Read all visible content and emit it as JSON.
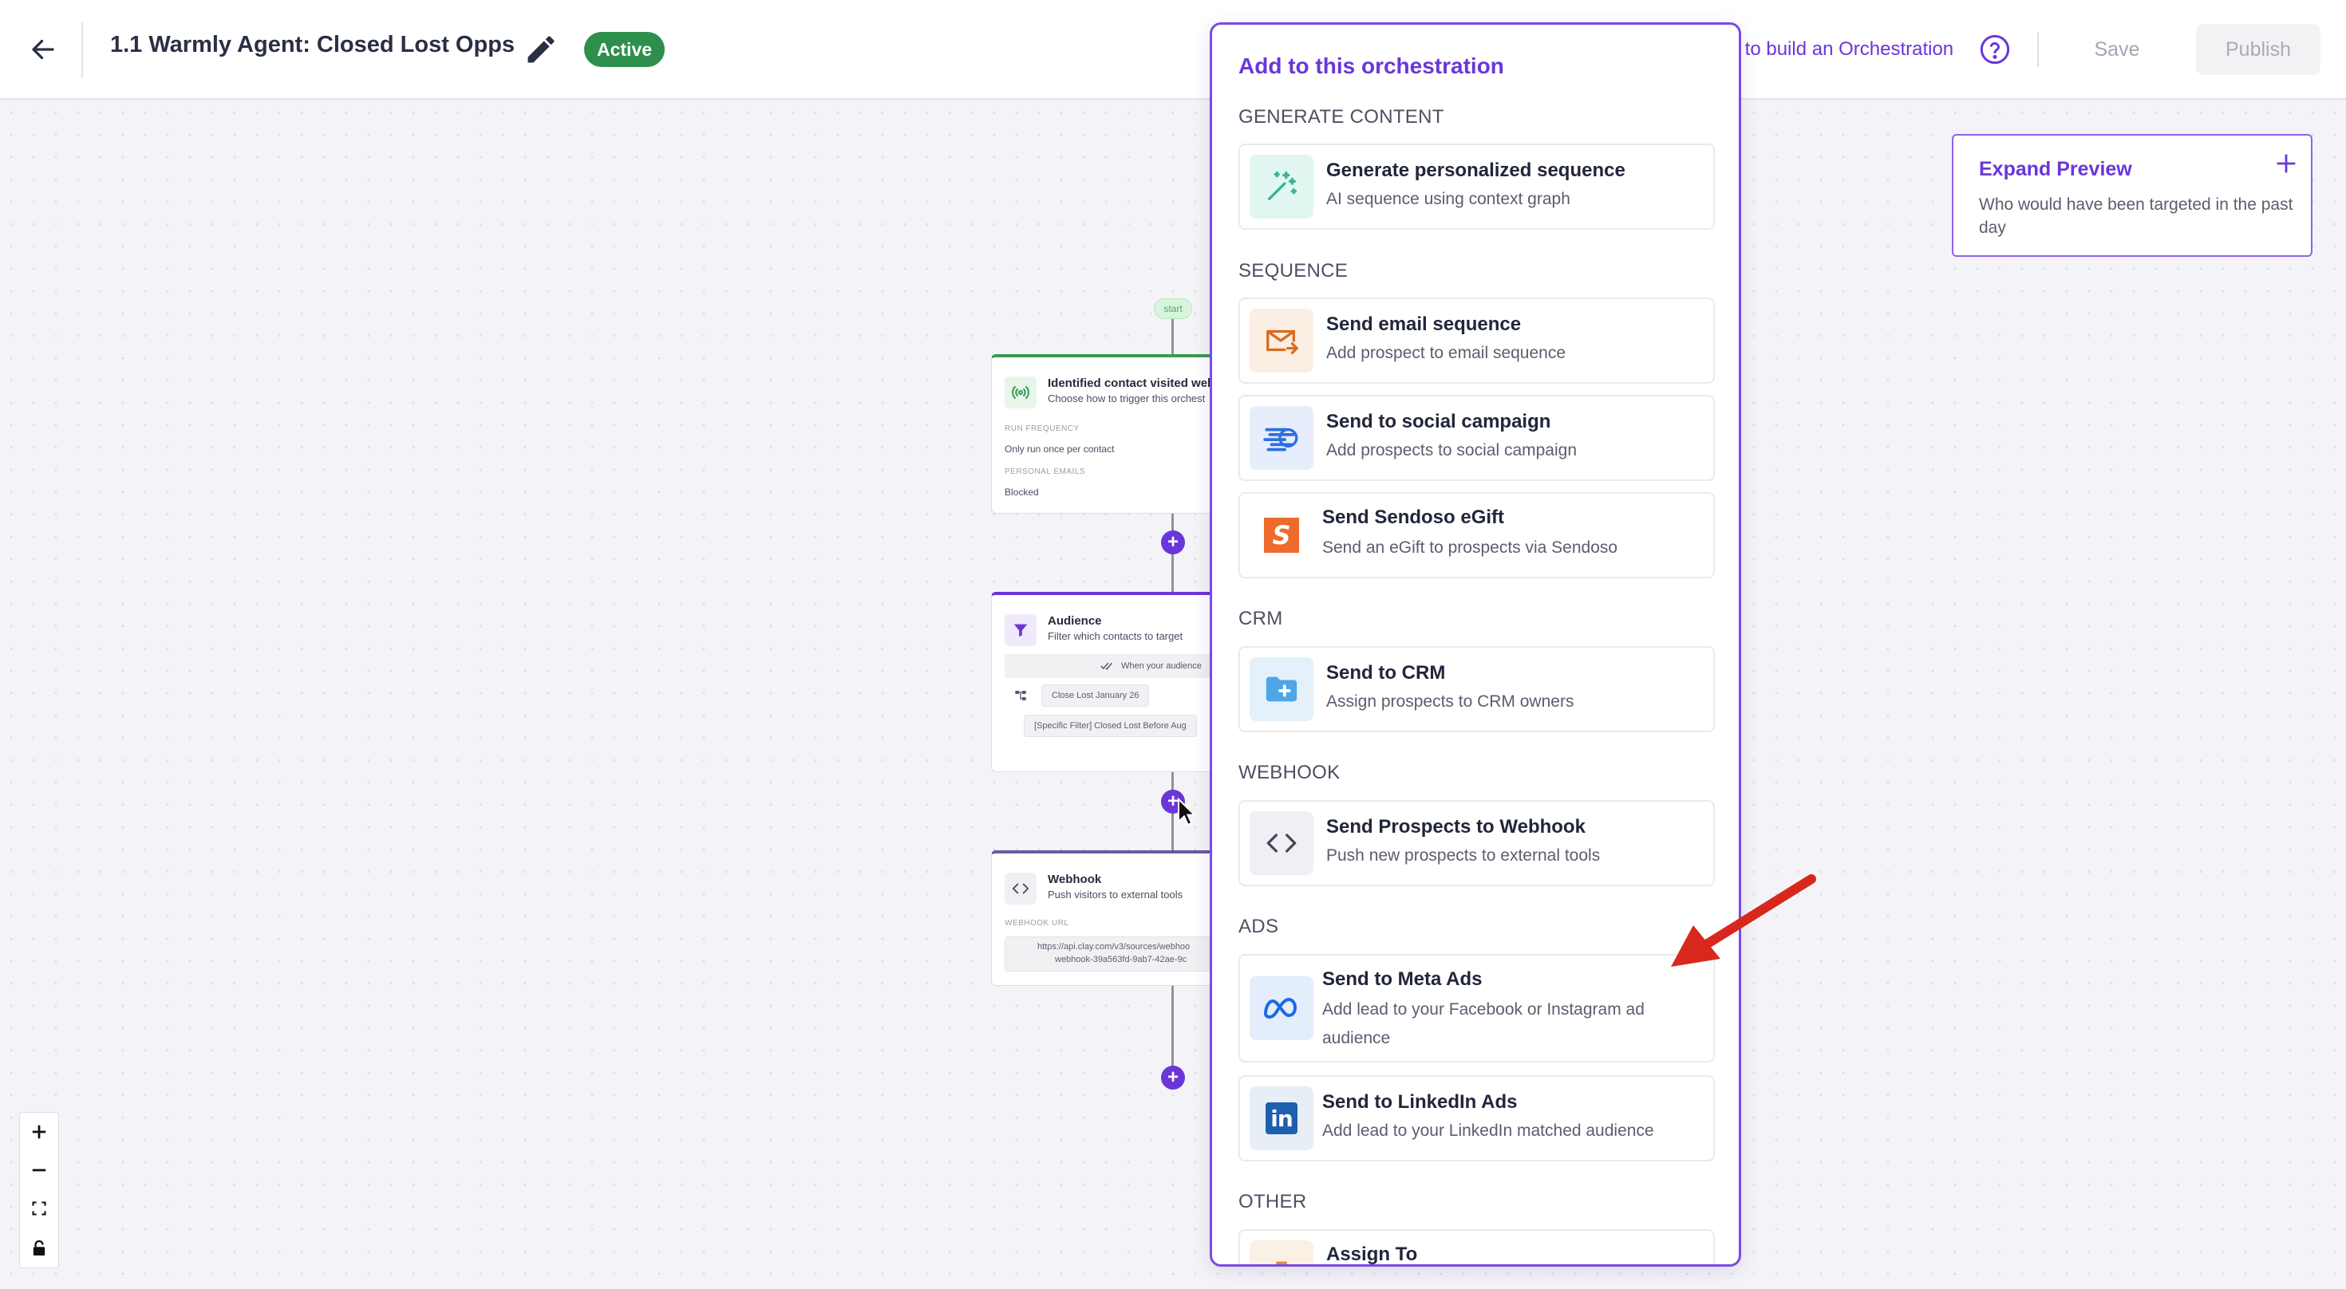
{
  "header": {
    "title": "1.1 Warmly Agent: Closed Lost Opps",
    "status": "Active",
    "help_link": "y to build an Orchestration",
    "save": "Save",
    "publish": "Publish"
  },
  "canvas": {
    "start_label": "start",
    "nodes": [
      {
        "title": "Identified contact visited web",
        "subtitle": "Choose how to trigger this orchest",
        "fields": [
          {
            "label": "RUN FREQUENCY",
            "value": "Only run once per contact"
          },
          {
            "label": "PERSONAL EMAILS",
            "value": "Blocked"
          }
        ]
      },
      {
        "title": "Audience",
        "subtitle": "Filter which contacts to target",
        "condition": "When your audience",
        "chip1": "Close Lost January 26",
        "chip2": "[Specific Filter] Closed Lost Before Aug"
      },
      {
        "title": "Webhook",
        "subtitle": "Push visitors to external tools",
        "field_label": "WEBHOOK URL",
        "url_line1": "https://api.clay.com/v3/sources/webhoo",
        "url_line2": "webhook-39a563fd-9ab7-42ae-9c"
      }
    ]
  },
  "preview": {
    "title": "Expand Preview",
    "description": "Who would have been targeted in the past day"
  },
  "panel": {
    "title": "Add to this orchestration",
    "sections": [
      {
        "heading": "GENERATE CONTENT",
        "items": [
          {
            "title": "Generate personalized sequence",
            "desc": "AI sequence using context graph",
            "icon": "magic-wand-icon"
          }
        ]
      },
      {
        "heading": "SEQUENCE",
        "items": [
          {
            "title": "Send email sequence",
            "desc": "Add prospect to email sequence",
            "icon": "email-send-icon"
          },
          {
            "title": "Send to social campaign",
            "desc": "Add prospects to social campaign",
            "icon": "social-campaign-icon"
          },
          {
            "title": "Send Sendoso eGift",
            "desc": "Send an eGift to prospects via Sendoso",
            "icon": "sendoso-logo-icon"
          }
        ]
      },
      {
        "heading": "CRM",
        "items": [
          {
            "title": "Send to CRM",
            "desc": "Assign prospects to CRM owners",
            "icon": "crm-folder-icon"
          }
        ]
      },
      {
        "heading": "WEBHOOK",
        "items": [
          {
            "title": "Send Prospects to Webhook",
            "desc": "Push new prospects to external tools",
            "icon": "code-brackets-icon"
          }
        ]
      },
      {
        "heading": "ADS",
        "items": [
          {
            "title": "Send to Meta Ads",
            "desc": "Add lead to your Facebook or Instagram ad audience",
            "icon": "meta-logo-icon"
          },
          {
            "title": "Send to LinkedIn Ads",
            "desc": "Add lead to your LinkedIn matched audience",
            "icon": "linkedin-logo-icon"
          }
        ]
      },
      {
        "heading": "OTHER",
        "items": [
          {
            "title": "Assign To",
            "desc": "",
            "icon": "briefcase-icon"
          }
        ]
      }
    ]
  },
  "colors": {
    "accent": "#6a36d9",
    "active_badge": "#2e8f4d",
    "annotation_arrow": "#d8281e"
  }
}
